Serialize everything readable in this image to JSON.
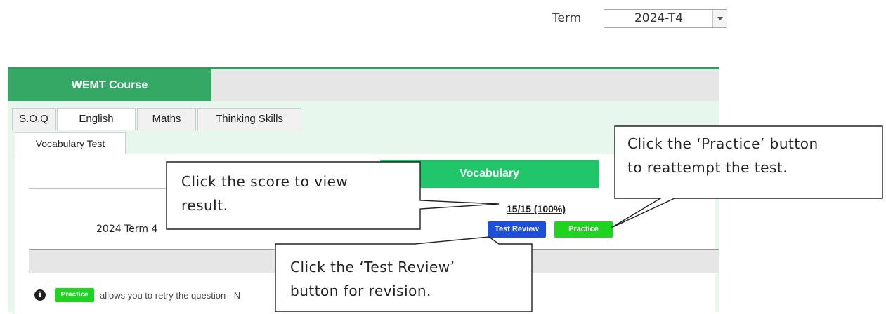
{
  "term": {
    "label": "Term",
    "value": "2024-T4"
  },
  "course": {
    "title": "WEMT Course"
  },
  "subject_tabs": [
    "S.O.Q",
    "English",
    "Maths",
    "Thinking Skills"
  ],
  "subtab": "Vocabulary Test",
  "table": {
    "column_header": "Vocabulary",
    "row_label": "2024 Term 4",
    "score": "15/15 (100%)",
    "review_label": "Test Review",
    "practice_label": "Practice"
  },
  "info": {
    "practice_label": "Practice",
    "text": "allows you to retry the question - N"
  },
  "callouts": {
    "score": [
      "Click the score to view",
      "result."
    ],
    "practice": [
      "Click the ‘Practice’ button",
      "to reattempt the test."
    ],
    "review": [
      "Click the ‘Test Review’",
      "button for revision."
    ]
  },
  "colors": {
    "course_green": "#34a864",
    "panel_bg": "#e8f7ee",
    "header_green": "#22c66a",
    "review_blue": "#1e4fd8",
    "practice_green": "#1ed41e"
  }
}
